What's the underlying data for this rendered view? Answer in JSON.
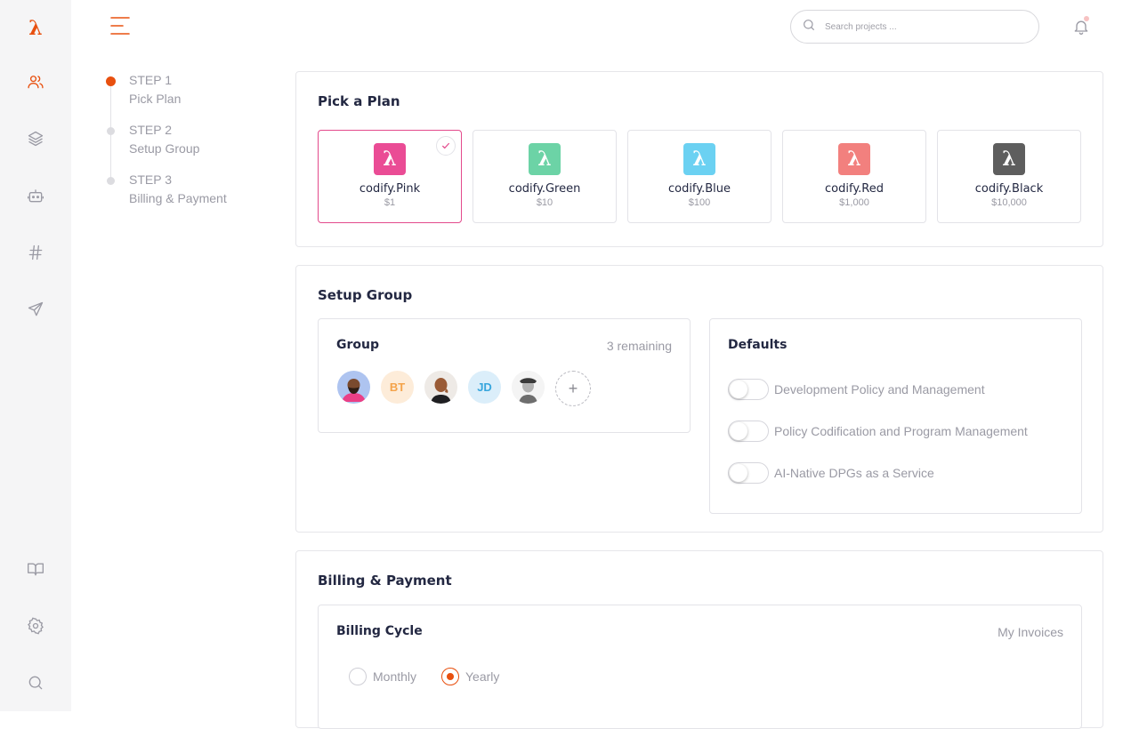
{
  "brand": {
    "logo_glyph": "λ",
    "accent": "#e8500f"
  },
  "rail": {
    "icons": [
      "users-icon",
      "layers-icon",
      "robot-icon",
      "hash-icon",
      "send-icon",
      "book-icon",
      "settings-icon",
      "search-icon"
    ]
  },
  "search": {
    "placeholder": "Search projects ..."
  },
  "steps": [
    {
      "num": "STEP 1",
      "label": "Pick Plan",
      "active": true
    },
    {
      "num": "STEP 2",
      "label": "Setup Group",
      "active": false
    },
    {
      "num": "STEP 3",
      "label": "Billing & Payment",
      "active": false
    }
  ],
  "plan_section": {
    "title": "Pick a Plan",
    "plans": [
      {
        "name": "codify.Pink",
        "price": "$1",
        "color": "#ea4c95",
        "selected": true
      },
      {
        "name": "codify.Green",
        "price": "$10",
        "color": "#6cd3a6",
        "selected": false
      },
      {
        "name": "codify.Blue",
        "price": "$100",
        "color": "#6bd1f2",
        "selected": false
      },
      {
        "name": "codify.Red",
        "price": "$1,000",
        "color": "#f2807e",
        "selected": false
      },
      {
        "name": "codify.Black",
        "price": "$10,000",
        "color": "#5e5e5e",
        "selected": false
      }
    ]
  },
  "group_section": {
    "title": "Setup Group",
    "group": {
      "title": "Group",
      "remaining": "3 remaining",
      "members": [
        {
          "type": "photo",
          "name": "avatar-photo-1"
        },
        {
          "type": "initials",
          "initials": "BT",
          "bg": "#fdecd9",
          "fg": "#f4a34a"
        },
        {
          "type": "photo",
          "name": "avatar-photo-2"
        },
        {
          "type": "initials",
          "initials": "JD",
          "bg": "#dbeefa",
          "fg": "#37a6dd"
        },
        {
          "type": "photo",
          "name": "avatar-photo-3"
        }
      ],
      "add_label": "+"
    },
    "defaults": {
      "title": "Defaults",
      "items": [
        {
          "label": "Development Policy and Management",
          "on": false
        },
        {
          "label": "Policy Codification and Program Management",
          "on": false
        },
        {
          "label": "AI-Native DPGs as a Service",
          "on": false
        }
      ]
    }
  },
  "billing_section": {
    "title": "Billing & Payment",
    "cycle": {
      "title": "Billing Cycle",
      "invoices_link": "My Invoices",
      "options": [
        {
          "label": "Monthly",
          "selected": false
        },
        {
          "label": "Yearly",
          "selected": true
        }
      ]
    }
  }
}
